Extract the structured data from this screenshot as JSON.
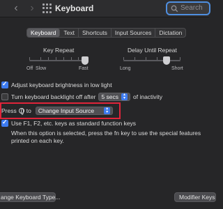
{
  "window": {
    "title": "Keyboard"
  },
  "search": {
    "placeholder": "Search"
  },
  "tabs": [
    {
      "label": "Keyboard",
      "active": true
    },
    {
      "label": "Text",
      "active": false
    },
    {
      "label": "Shortcuts",
      "active": false
    },
    {
      "label": "Input Sources",
      "active": false
    },
    {
      "label": "Dictation",
      "active": false
    }
  ],
  "key_repeat": {
    "title": "Key Repeat",
    "labels": {
      "off": "Off",
      "slow": "Slow",
      "fast": "Fast"
    },
    "value": 1.0
  },
  "delay_until_repeat": {
    "title": "Delay Until Repeat",
    "labels": {
      "long": "Long",
      "short": "Short"
    },
    "value": 0.75
  },
  "options": {
    "adjust_brightness": {
      "label": "Adjust keyboard brightness in low light",
      "checked": true
    },
    "backlight_off": {
      "label_before": "Turn keyboard backlight off after",
      "value": "5 secs",
      "label_after": "of inactivity",
      "checked": false
    },
    "press_globe": {
      "label_before": "Press",
      "label_to": "to",
      "value": "Change Input Source"
    },
    "fn_keys": {
      "label": "Use F1, F2, etc. keys as standard function keys",
      "checked": true,
      "note": "When this option is selected, press the fn key to use the special features printed on each key."
    }
  },
  "buttons": {
    "change_keyboard_type": "ange Keyboard Type...",
    "modifier_keys": "Modifier Keys"
  },
  "colors": {
    "accent": "#3d7bf0",
    "highlight": "#e0243a",
    "background": "#262628"
  }
}
